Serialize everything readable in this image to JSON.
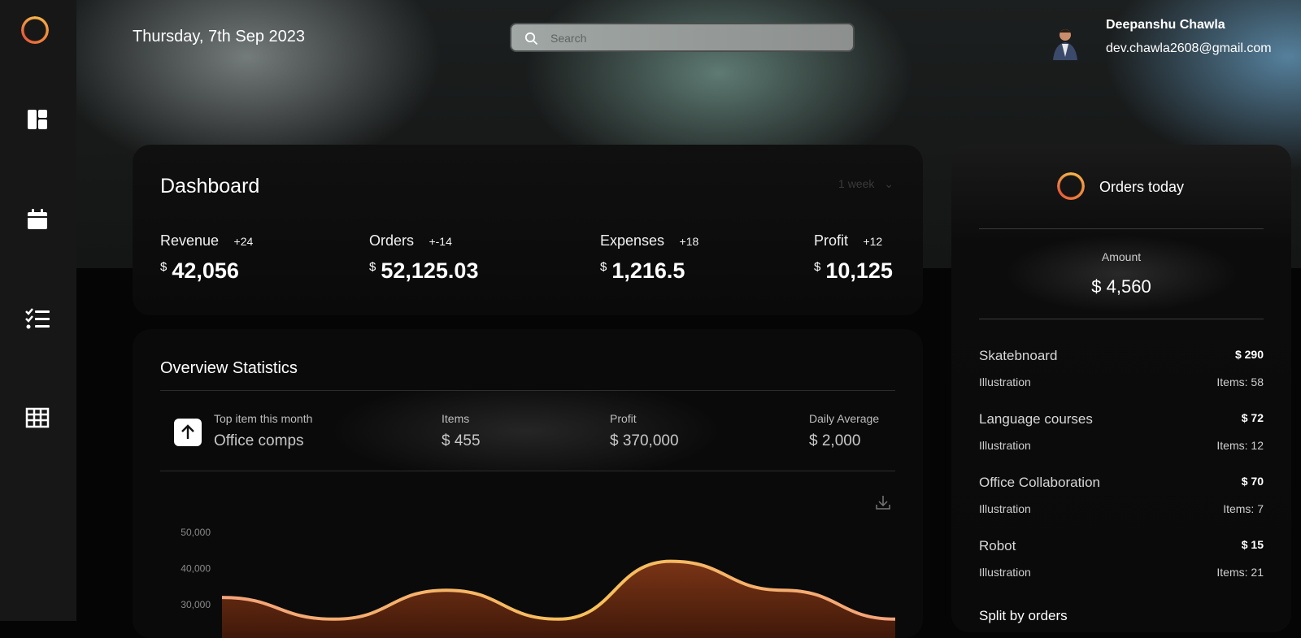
{
  "header": {
    "date": "Thursday, 7th Sep 2023",
    "search_placeholder": "Search",
    "user_name": "Deepanshu Chawla",
    "user_email": "dev.chawla2608@gmail.com"
  },
  "sidebar": {
    "items": [
      "dashboard-icon",
      "calendar-icon",
      "checklist-icon",
      "table-icon"
    ]
  },
  "dashboard": {
    "title": "Dashboard",
    "period": "1 week",
    "stats": [
      {
        "label": "Revenue",
        "change": "+24",
        "currency": "$",
        "value": "42,056"
      },
      {
        "label": "Orders",
        "change": "+-14",
        "currency": "$",
        "value": "52,125.03"
      },
      {
        "label": "Expenses",
        "change": "+18",
        "currency": "$",
        "value": "1,216.5"
      },
      {
        "label": "Profit",
        "change": "+12",
        "currency": "$",
        "value": "10,125"
      }
    ]
  },
  "overview": {
    "title": "Overview Statistics",
    "top_item_label": "Top item this month",
    "top_item_value": "Office comps",
    "items_label": "Items",
    "items_value": "$ 455",
    "profit_label": "Profit",
    "profit_value": "$ 370,000",
    "daily_label": "Daily Average",
    "daily_value": "$ 2,000"
  },
  "chart_data": {
    "type": "area",
    "y_ticks": [
      "50,000",
      "40,000",
      "30,000"
    ],
    "ylim": [
      0,
      50000
    ],
    "series": [
      {
        "values": [
          32000,
          26000,
          34000,
          26000,
          42000,
          34000,
          26000
        ]
      }
    ],
    "colors": {
      "stroke_start": "#f4a37b",
      "stroke_peak": "#f7c15a",
      "fill": "#6b2c12"
    }
  },
  "orders_today": {
    "title": "Orders today",
    "amount_label": "Amount",
    "amount_value": "$ 4,560",
    "items": [
      {
        "name": "Skatebnoard",
        "price": "$ 290",
        "category": "Illustration",
        "items": "Items: 58"
      },
      {
        "name": "Language courses",
        "price": "$ 72",
        "category": "Illustration",
        "items": "Items: 12"
      },
      {
        "name": "Office Collaboration",
        "price": "$ 70",
        "category": "Illustration",
        "items": "Items: 7"
      },
      {
        "name": "Robot",
        "price": "$ 15",
        "category": "Illustration",
        "items": "Items: 21"
      }
    ],
    "split_title": "Split by orders"
  }
}
